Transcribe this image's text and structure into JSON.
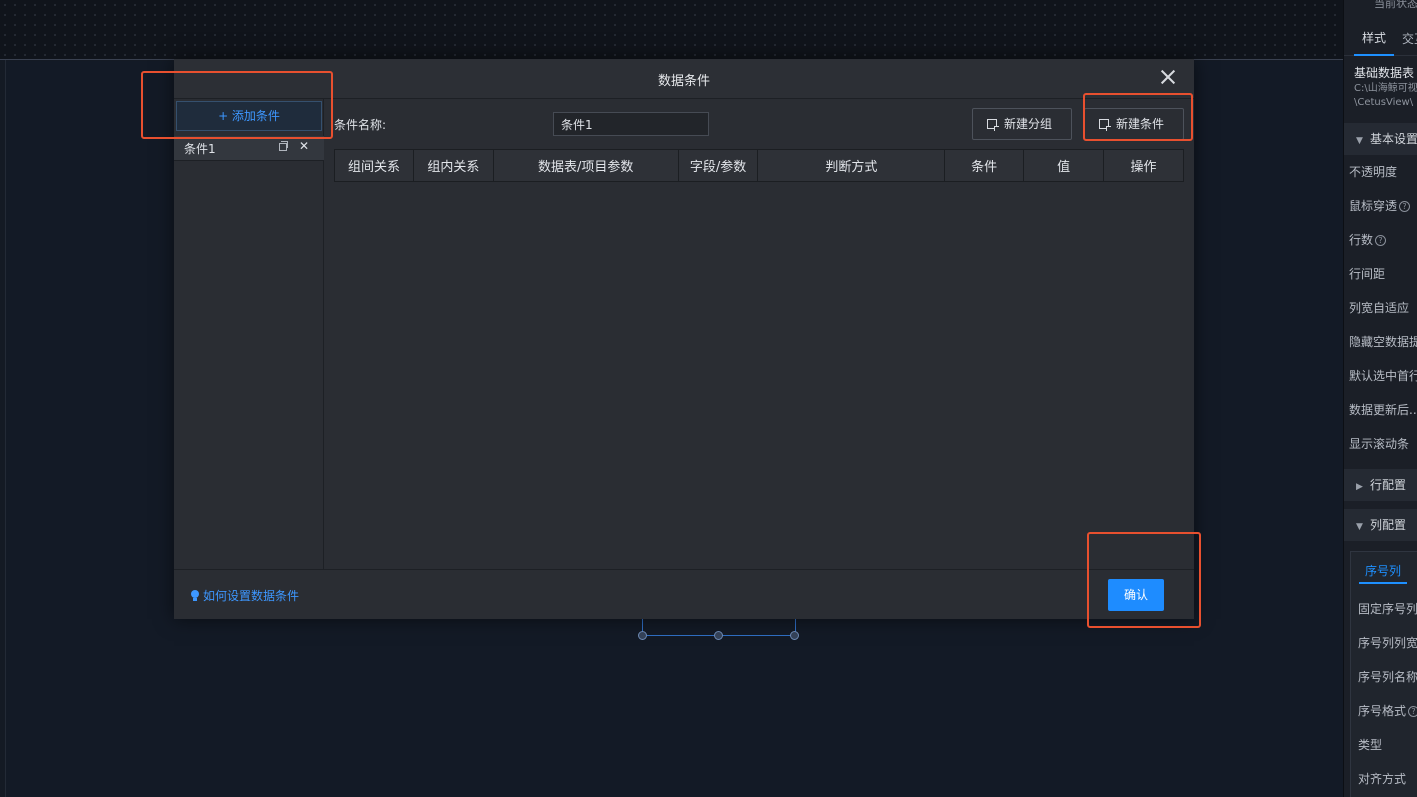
{
  "modal": {
    "title": "数据条件",
    "add_condition_label": "+ 添加条件",
    "conditions": [
      {
        "label": "条件1"
      }
    ],
    "name_label": "条件名称:",
    "name_value": "条件1",
    "new_group_label": "新建分组",
    "new_condition_label": "新建条件",
    "table_headers": [
      "组间关系",
      "组内关系",
      "数据表/项目参数",
      "字段/参数",
      "判断方式",
      "条件",
      "值",
      "操作"
    ],
    "help_link": "如何设置数据条件",
    "confirm_label": "确认"
  },
  "right_panel": {
    "top_text": "当前状态",
    "tabs": [
      "样式",
      "交互"
    ],
    "component_title": "基础数据表",
    "path_lines": [
      "C:\\山海鲸可视化",
      "\\CetusView\\"
    ],
    "section_basic": "基本设置",
    "basic_rows": [
      "不透明度",
      "鼠标穿透",
      "行数",
      "行间距",
      "列宽自适应",
      "隐藏空数据提示",
      "默认选中首行",
      "数据更新后...",
      "显示滚动条"
    ],
    "section_row": "行配置",
    "section_col": "列配置",
    "col_tab": "序号列",
    "col_rows": [
      "固定序号列",
      "序号列列宽",
      "序号列名称",
      "序号格式",
      "类型",
      "对齐方式"
    ]
  },
  "colors": {
    "accent": "#1e8cff",
    "annotation": "#e8502f",
    "dialog_bg": "#2a2d33",
    "canvas_bg": "#131a26"
  }
}
